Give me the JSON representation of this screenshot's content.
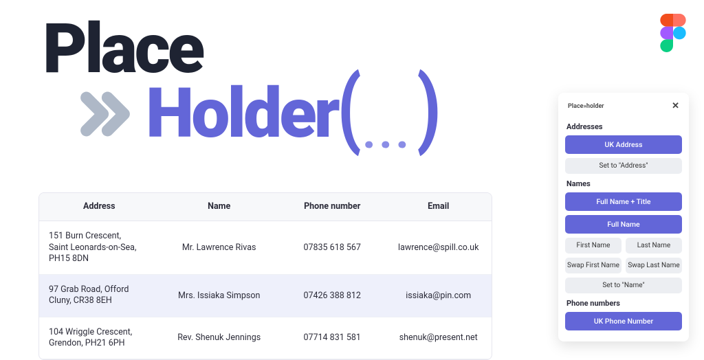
{
  "logo": {
    "line1": "Place",
    "line2": "Holder",
    "paren_open": "(",
    "paren_close": ")",
    "dots": "..."
  },
  "table": {
    "headers": {
      "address": "Address",
      "name": "Name",
      "phone": "Phone number",
      "email": "Email"
    },
    "rows": [
      {
        "address": "151 Burn Crescent,\nSaint Leonards-on-Sea,\nPH15 8DN",
        "name": "Mr. Lawrence Rivas",
        "phone": "07835 618 567",
        "email": "lawrence@spill.co.uk"
      },
      {
        "address": "97 Grab Road, Offord\nCluny, CR38 8EH",
        "name": "Mrs. Issiaka Simpson",
        "phone": "07426 388 812",
        "email": "issiaka@pin.com"
      },
      {
        "address": "104 Wriggle Crescent,\nGrendon, PH21 6PH",
        "name": "Rev. Shenuk Jennings",
        "phone": "07714 831 581",
        "email": "shenuk@present.net"
      }
    ]
  },
  "panel": {
    "title": "Place»holder",
    "sections": {
      "addresses": {
        "title": "Addresses",
        "uk_address": "UK Address",
        "set_to": "Set to \"Address\""
      },
      "names": {
        "title": "Names",
        "full_title": "Full Name + Title",
        "full": "Full Name",
        "first": "First Name",
        "last": "Last Name",
        "swap_first": "Swap First Name",
        "swap_last": "Swap Last Name",
        "set_to": "Set to \"Name\""
      },
      "phones": {
        "title": "Phone numbers",
        "uk_phone": "UK Phone Number"
      }
    }
  }
}
